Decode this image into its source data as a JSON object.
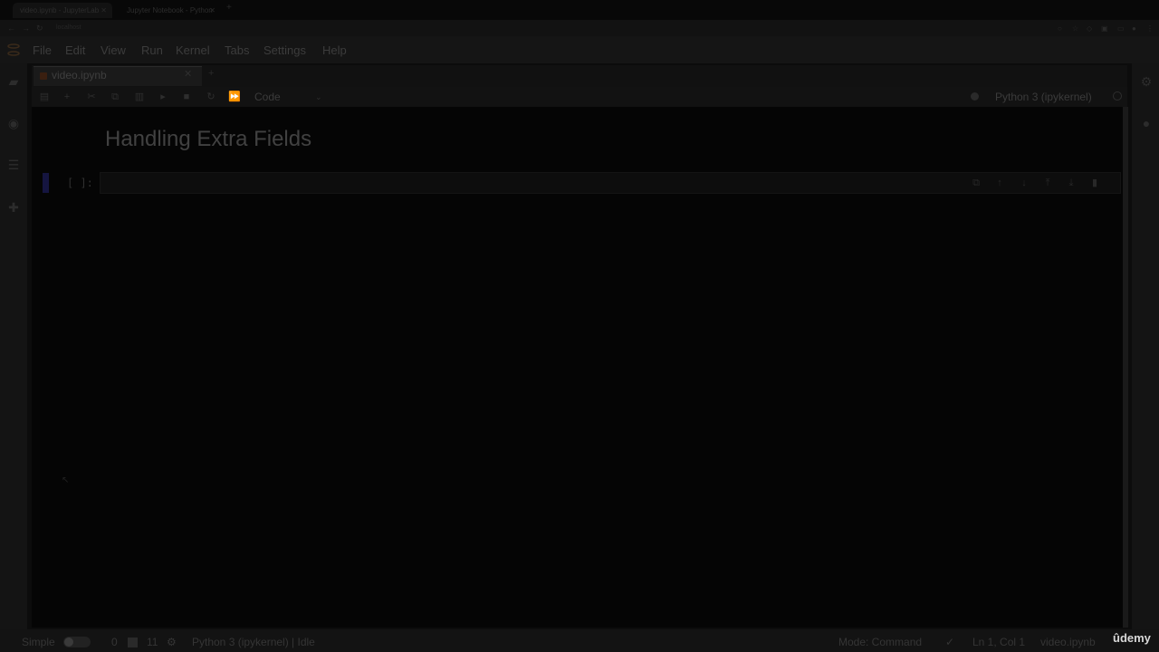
{
  "browser": {
    "tabs": [
      {
        "label": "video.ipynb - JupyterLab"
      },
      {
        "label": "Jupyter Notebook - Python"
      }
    ],
    "new_tab": "+",
    "url": "localhost"
  },
  "menubar": {
    "items": [
      "File",
      "Edit",
      "View",
      "Run",
      "Kernel",
      "Tabs",
      "Settings",
      "Help"
    ]
  },
  "document": {
    "tab_label": "video.ipynb",
    "cell_type": "Code",
    "kernel": "Python 3 (ipykernel)"
  },
  "notebook": {
    "heading": "Handling Extra Fields",
    "cell_prompt": "[ ]:"
  },
  "statusbar": {
    "mode_label": "Simple",
    "terminals": "0",
    "kernels": "11",
    "kernel_status": "Python 3 (ipykernel) | Idle",
    "mode": "Mode: Command",
    "position": "Ln 1, Col 1",
    "filename": "video.ipynb"
  },
  "watermark": "ûdemy",
  "colors": {
    "background": "#0c0c0c",
    "active_cell_marker": "#151540",
    "dimmed_overlay": "#000000"
  },
  "icons": {
    "toolbar": [
      "save-icon",
      "add-cell-icon",
      "cut-icon",
      "copy-icon",
      "paste-icon",
      "run-icon",
      "stop-icon",
      "restart-icon",
      "fast-forward-icon"
    ],
    "cell_tools": [
      "duplicate-icon",
      "move-up-icon",
      "move-down-icon",
      "insert-above-icon",
      "insert-below-icon",
      "delete-icon"
    ],
    "sidebar": [
      "folder-icon",
      "running-icon",
      "toc-icon",
      "extension-icon"
    ]
  }
}
